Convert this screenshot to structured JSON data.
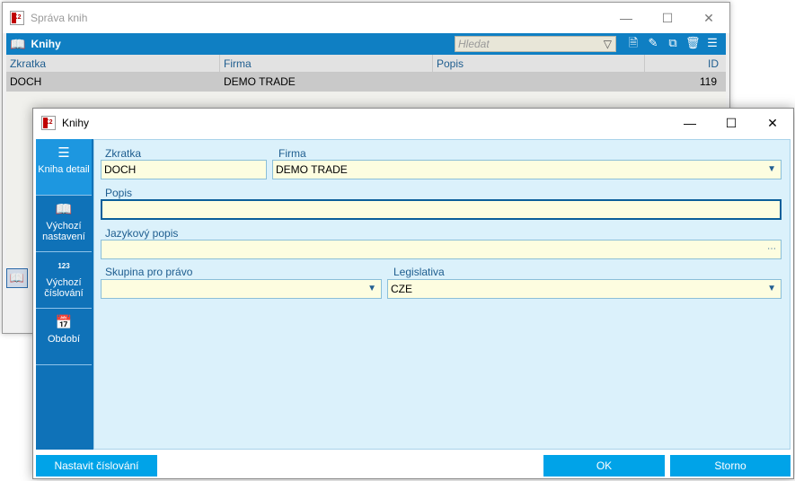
{
  "bg_window": {
    "title": "Správa knih",
    "toolbar_label": "Knihy",
    "search_placeholder": "Hledat",
    "columns": [
      "Zkratka",
      "Firma",
      "Popis",
      "ID"
    ],
    "rows": [
      {
        "zkratka": "DOCH",
        "firma": "DEMO TRADE",
        "popis": "",
        "id": "119"
      }
    ]
  },
  "dialog": {
    "title": "Knihy",
    "sidebar": [
      {
        "label": "Kniha detail",
        "icon": "list-icon",
        "active": true
      },
      {
        "label": "Výchozí nastavení",
        "icon": "book-icon",
        "active": false
      },
      {
        "label": "Výchozí číslování",
        "icon": "numbering-icon",
        "icon_text": "123",
        "active": false
      },
      {
        "label": "Období",
        "icon": "calendar-icon",
        "active": false
      }
    ],
    "fields": {
      "zkratka": {
        "label": "Zkratka",
        "value": "DOCH"
      },
      "firma": {
        "label": "Firma",
        "value": "DEMO TRADE"
      },
      "popis": {
        "label": "Popis",
        "value": ""
      },
      "jazykovy_popis": {
        "label": "Jazykový popis",
        "value": ""
      },
      "skupina": {
        "label": "Skupina pro právo",
        "value": ""
      },
      "legislativa": {
        "label": "Legislativa",
        "value": "CZE"
      }
    },
    "buttons": {
      "numbering": "Nastavit číslování",
      "ok": "OK",
      "cancel": "Storno"
    }
  },
  "colors": {
    "accent": "#0f72b8",
    "sidebar_active": "#1d97e0",
    "button": "#00a3e8",
    "field_bg": "#fdfde0",
    "form_bg": "#dbf1fb"
  }
}
